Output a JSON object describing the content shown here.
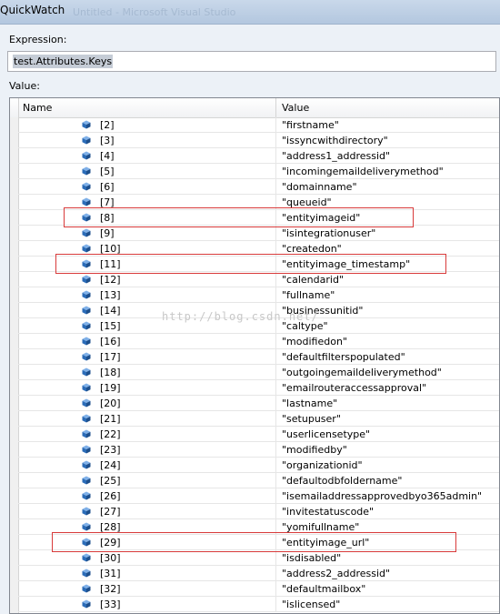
{
  "window": {
    "title": "QuickWatch",
    "title_blurred": "Untitled - Microsoft Visual Studio"
  },
  "expression": {
    "label": "Expression:",
    "value": "test.Attributes.Keys"
  },
  "value_section": {
    "label": "Value:"
  },
  "grid": {
    "headers": {
      "name": "Name",
      "value": "Value"
    },
    "rows": [
      {
        "index": "[2]",
        "value": "\"firstname\""
      },
      {
        "index": "[3]",
        "value": "\"issyncwithdirectory\""
      },
      {
        "index": "[4]",
        "value": "\"address1_addressid\""
      },
      {
        "index": "[5]",
        "value": "\"incomingemaildeliverymethod\""
      },
      {
        "index": "[6]",
        "value": "\"domainname\""
      },
      {
        "index": "[7]",
        "value": "\"queueid\""
      },
      {
        "index": "[8]",
        "value": "\"entityimageid\"",
        "highlighted": true
      },
      {
        "index": "[9]",
        "value": "\"isintegrationuser\""
      },
      {
        "index": "[10]",
        "value": "\"createdon\""
      },
      {
        "index": "[11]",
        "value": "\"entityimage_timestamp\"",
        "highlighted": true
      },
      {
        "index": "[12]",
        "value": "\"calendarid\""
      },
      {
        "index": "[13]",
        "value": "\"fullname\""
      },
      {
        "index": "[14]",
        "value": "\"businessunitid\""
      },
      {
        "index": "[15]",
        "value": "\"caltype\""
      },
      {
        "index": "[16]",
        "value": "\"modifiedon\""
      },
      {
        "index": "[17]",
        "value": "\"defaultfilterspopulated\""
      },
      {
        "index": "[18]",
        "value": "\"outgoingemaildeliverymethod\""
      },
      {
        "index": "[19]",
        "value": "\"emailrouteraccessapproval\""
      },
      {
        "index": "[20]",
        "value": "\"lastname\""
      },
      {
        "index": "[21]",
        "value": "\"setupuser\""
      },
      {
        "index": "[22]",
        "value": "\"userlicensetype\""
      },
      {
        "index": "[23]",
        "value": "\"modifiedby\""
      },
      {
        "index": "[24]",
        "value": "\"organizationid\""
      },
      {
        "index": "[25]",
        "value": "\"defaultodbfoldername\""
      },
      {
        "index": "[26]",
        "value": "\"isemailaddressapprovedbyo365admin\""
      },
      {
        "index": "[27]",
        "value": "\"invitestatuscode\""
      },
      {
        "index": "[28]",
        "value": "\"yomifullname\""
      },
      {
        "index": "[29]",
        "value": "\"entityimage_url\"",
        "highlighted": true
      },
      {
        "index": "[30]",
        "value": "\"isdisabled\""
      },
      {
        "index": "[31]",
        "value": "\"address2_addressid\""
      },
      {
        "index": "[32]",
        "value": "\"defaultmailbox\""
      },
      {
        "index": "[33]",
        "value": "\"islicensed\""
      }
    ]
  },
  "watermark": "http://blog.csdn.net/",
  "colors": {
    "highlight_border": "#d83a3a",
    "icon_blue": "#2b6cb8",
    "title_bar": "#c9d8ea"
  },
  "icons": {
    "row_icon": "field-cube-icon"
  }
}
